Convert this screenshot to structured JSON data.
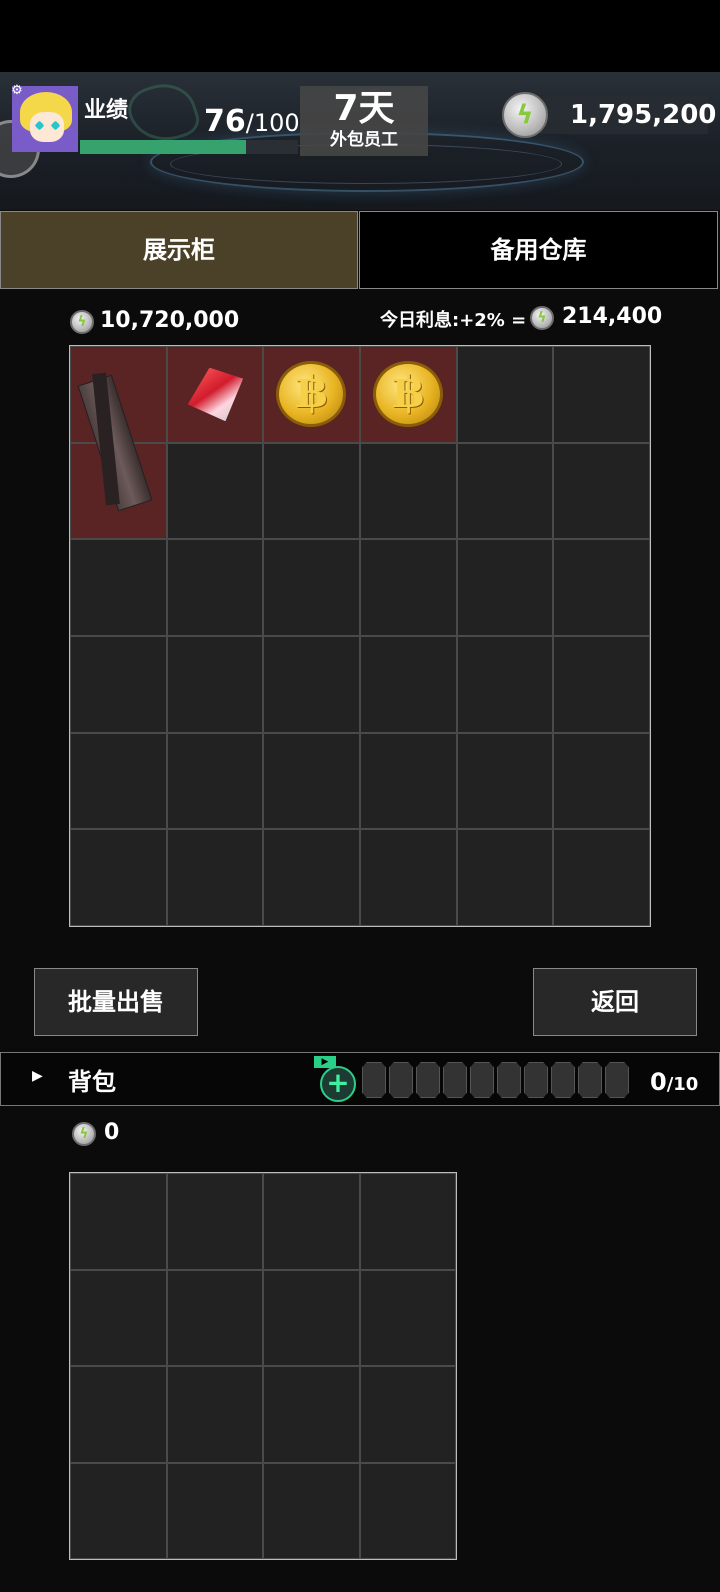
{
  "header": {
    "performance_label": "业绩",
    "performance_current": "76",
    "performance_max": "/100",
    "performance_progress": 0.76,
    "day_count": "7天",
    "job_title": "外包员工",
    "currency_total": "1,795,200",
    "currency_icon": "energy-coin-icon",
    "settings_icon": "gear-icon",
    "accent_color": "#36a36f"
  },
  "tabs": [
    {
      "label": "展示柜",
      "active": true
    },
    {
      "label": "备用仓库",
      "active": false
    }
  ],
  "showcase": {
    "total_value": "10,720,000",
    "interest_label": "今日利息:+2% =",
    "interest_value": "214,400",
    "grid_columns": 6,
    "grid_rows": 6,
    "items": [
      {
        "name": "wooden-stick-item",
        "cells": "column 1, rows 1-2"
      },
      {
        "name": "red-crystal-item",
        "cells": "column 2, row 1"
      },
      {
        "name": "bitcoin-coin-item",
        "cells": "column 3, row 1"
      },
      {
        "name": "bitcoin-coin-item",
        "cells": "column 4, row 1"
      }
    ]
  },
  "buttons": {
    "bulk_sell": "批量出售",
    "return": "返回"
  },
  "backpack": {
    "title": "背包",
    "count": "0",
    "capacity": "/10",
    "value": "0",
    "slots_total": 10,
    "grid_columns": 4,
    "grid_rows": 4
  }
}
